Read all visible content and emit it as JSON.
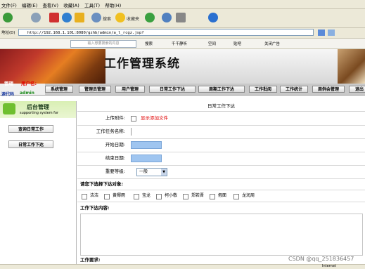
{
  "browser": {
    "menu": [
      "文件(F)",
      "编辑(E)",
      "查看(V)",
      "收藏(A)",
      "工具(T)",
      "帮助(H)"
    ],
    "toolbar": {
      "search_label": "搜索",
      "favorites_label": "收藏夹"
    },
    "address": {
      "label": "地址(D)",
      "url": "http://192.168.1.101:8080/gzhb/admin/a_l_rcgz.jsp?"
    },
    "searchbar": {
      "placeholder": "输入想要搜索的内容",
      "search": "搜索",
      "items": [
        "千千静听",
        "空间",
        "贴吧",
        "关闭广告"
      ]
    }
  },
  "header": {
    "title": "工作管理系统"
  },
  "nav": {
    "user_label": "用户名:",
    "mgmt_label": "管理",
    "admin_label": "admin",
    "source_label": "源代码",
    "items": [
      "系统管理",
      "管理员管理",
      "用户管理",
      "日常工作下达",
      "周期工作下达",
      "工作批阅",
      "工作统计",
      "周例会管理",
      "退出"
    ]
  },
  "sidebar": {
    "title": "后台管理",
    "subtitle": "supporting system for",
    "buttons": [
      "查询日常工作",
      "日常工作下达"
    ]
  },
  "form": {
    "title": "日常工作下达",
    "attachment_label": "上传附件:",
    "attachment_link": "显示添加文件",
    "task_name_label": "工作任务名称:",
    "start_date_label": "开始日期:",
    "end_date_label": "结束日期:",
    "importance_label": "重要等级:",
    "importance_value": "一般",
    "assignees_label": "请您下选择下达对象:",
    "assignees": [
      "洁洁",
      "黄椰雨",
      "宝龙",
      "柯小敬",
      "郑若晋",
      "假面",
      "龙润周"
    ],
    "content_label": "工作下达内容:",
    "requirements_label": "工作要求:"
  },
  "status": {
    "text": "Internet"
  },
  "watermark": "CSDN @qq_251836457",
  "colors": {
    "link_red": "#e00000",
    "date_fill": "#9fc5f0",
    "sidebar_green": "#d9efb4"
  }
}
